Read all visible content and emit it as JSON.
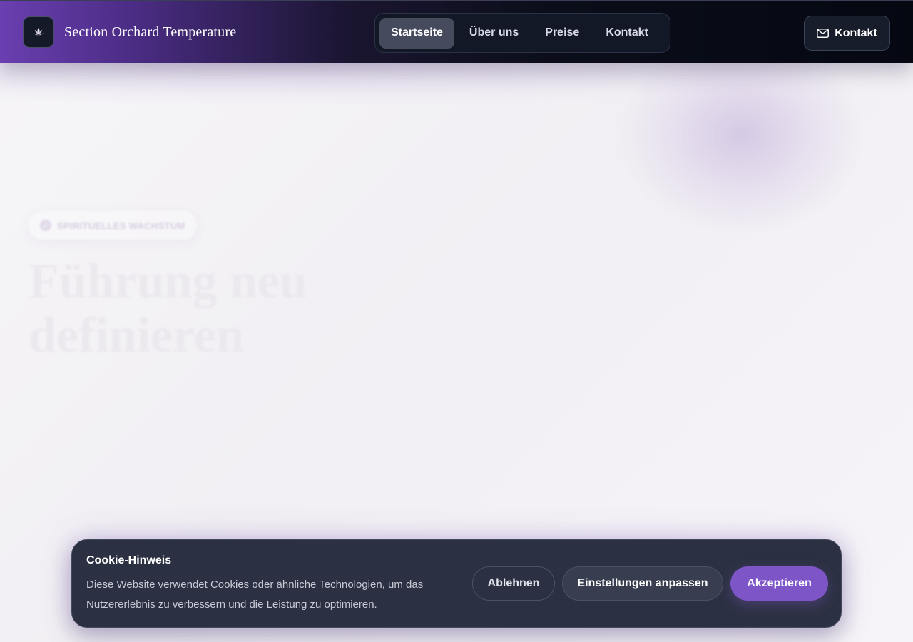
{
  "header": {
    "brand_name": "Section Orchard Temperature",
    "logo_icon": "lotus-icon",
    "nav": [
      {
        "label": "Startseite",
        "active": true
      },
      {
        "label": "Über uns",
        "active": false
      },
      {
        "label": "Preise",
        "active": false
      },
      {
        "label": "Kontakt",
        "active": false
      }
    ],
    "contact_button": {
      "label": "Kontakt",
      "icon": "envelope-icon"
    }
  },
  "hero": {
    "badge": "SPIRITUELLES WACHSTUM",
    "badge_icon": "check-circle-icon",
    "title_line1": "Führung neu",
    "title_line2": "definieren"
  },
  "cookie_banner": {
    "title": "Cookie-Hinweis",
    "text": "Diese Website verwendet Cookies oder ähnliche Technologien, um das Nutzererlebnis zu verbessern und die Leistung zu optimieren.",
    "decline_label": "Ablehnen",
    "settings_label": "Einstellungen anpassen",
    "accept_label": "Akzeptieren"
  },
  "colors": {
    "accent": "#7d55c7",
    "header_start": "#6a3fb0",
    "header_end": "#050811",
    "banner_bg": "#2b3142"
  }
}
